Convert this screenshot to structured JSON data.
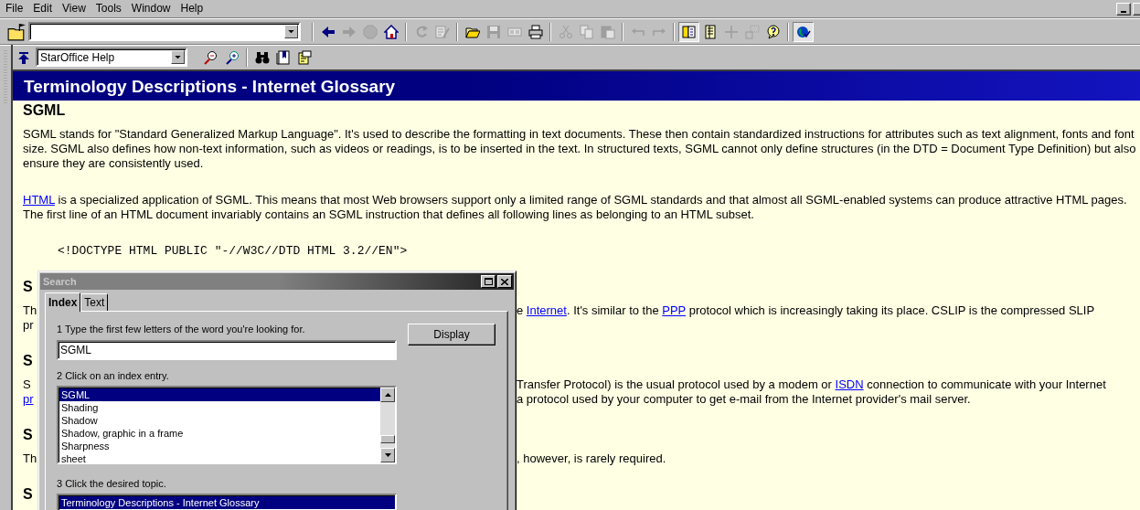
{
  "menu": [
    {
      "label": "File"
    },
    {
      "label": "Edit"
    },
    {
      "label": "View"
    },
    {
      "label": "Tools"
    },
    {
      "label": "Window"
    },
    {
      "label": "Help"
    }
  ],
  "toolbar": {
    "lead": [
      {
        "kind": "folder-flag",
        "disabled": false,
        "pressed": false
      }
    ],
    "groups": [
      [
        {
          "kind": "arrow-left",
          "disabled": false,
          "pressed": false
        },
        {
          "kind": "arrow-right",
          "disabled": true,
          "pressed": false
        },
        {
          "kind": "octagon",
          "disabled": true,
          "pressed": false
        },
        {
          "kind": "home",
          "disabled": false,
          "pressed": false
        }
      ],
      [
        {
          "kind": "refresh",
          "disabled": true,
          "pressed": false
        },
        {
          "kind": "document-pencil",
          "disabled": true,
          "pressed": false
        }
      ],
      [
        {
          "kind": "open-folder",
          "disabled": false,
          "pressed": false
        },
        {
          "kind": "save",
          "disabled": true,
          "pressed": false
        },
        {
          "kind": "form-field",
          "disabled": true,
          "pressed": false
        },
        {
          "kind": "printer",
          "disabled": false,
          "pressed": false
        }
      ],
      [
        {
          "kind": "scissors",
          "disabled": true,
          "pressed": false
        },
        {
          "kind": "copy",
          "disabled": true,
          "pressed": false
        },
        {
          "kind": "paste",
          "disabled": true,
          "pressed": false
        }
      ],
      [
        {
          "kind": "undo",
          "disabled": true,
          "pressed": false
        },
        {
          "kind": "redo",
          "disabled": true,
          "pressed": false
        }
      ],
      [
        {
          "kind": "book",
          "disabled": false,
          "pressed": true
        },
        {
          "kind": "list",
          "disabled": false,
          "pressed": false
        },
        {
          "kind": "crosshair",
          "disabled": true,
          "pressed": false
        },
        {
          "kind": "grid",
          "disabled": true,
          "pressed": false
        },
        {
          "kind": "help",
          "disabled": false,
          "pressed": false
        }
      ],
      [
        {
          "kind": "globe",
          "disabled": false,
          "pressed": true
        }
      ]
    ]
  },
  "help_toolbar": {
    "lead": [
      {
        "kind": "arrow-up",
        "disabled": false,
        "pressed": false
      }
    ],
    "combo": "StarOffice Help",
    "groups": [
      [
        {
          "kind": "zoom-out",
          "disabled": false,
          "pressed": false
        },
        {
          "kind": "zoom-in",
          "disabled": false,
          "pressed": false
        }
      ],
      [
        {
          "kind": "binoculars",
          "disabled": false,
          "pressed": false
        },
        {
          "kind": "bookmark",
          "disabled": false,
          "pressed": false
        },
        {
          "kind": "notes",
          "disabled": false,
          "pressed": false
        }
      ]
    ]
  },
  "document": {
    "title": "Terminology Descriptions - Internet Glossary",
    "heading": "SGML",
    "paragraphs": [
      [
        {
          "text": "SGML stands for \"Standard Generalized Markup Language\". It's used to describe the formatting in text documents. These then contain standardized instructions for attributes such as text alignment, fonts and font size. SGML also defines how non-text information, such as videos or readings, is to be inserted in the text. In structured texts, SGML cannot only define structures (in the DTD = Document Type Definition) but also ensure they are consistently used.",
          "link": false
        }
      ],
      [
        {
          "text": "HTML",
          "link": true
        },
        {
          "text": " is a specialized application of SGML. This means that most Web browsers support only a limited range of SGML standards and that almost all SGML-enabled systems can produce attractive HTML pages. The first line of an HTML document invariably contains an SGML instruction that defines all following lines as belonging to an HTML subset.",
          "link": false
        }
      ]
    ],
    "code": "<!DOCTYPE HTML PUBLIC \"-//W3C//DTD HTML 3.2//EN\">",
    "cut_sections": [
      {
        "heading": "S",
        "lines": [
          {
            "left": [
              {
                "text": "Th",
                "link": false
              }
            ],
            "right": [
              {
                "text": "e ",
                "link": false
              },
              {
                "text": "Internet",
                "link": true
              },
              {
                "text": ". It's similar to the ",
                "link": false
              },
              {
                "text": "PPP",
                "link": true
              },
              {
                "text": " protocol which is increasingly taking its place. CSLIP is the compressed SLIP",
                "link": false
              }
            ]
          },
          {
            "left": [
              {
                "text": "pr",
                "link": false
              }
            ]
          }
        ]
      },
      {
        "heading": "S",
        "lines": [
          {
            "left": [
              {
                "text": "S",
                "link": false
              }
            ],
            "right": [
              {
                "text": "Transfer Protocol) is the usual protocol used by a modem or ",
                "link": false
              },
              {
                "text": "ISDN",
                "link": true
              },
              {
                "text": " connection to communicate with your Internet",
                "link": false
              }
            ]
          },
          {
            "left": [
              {
                "text": "pr",
                "link": true
              }
            ],
            "right": [
              {
                "text": "a protocol used by your computer to get e-mail from the Internet provider's mail server.",
                "link": false
              }
            ]
          }
        ]
      },
      {
        "heading": "S",
        "lines": [
          {
            "left": [
              {
                "text": "Th",
                "link": false
              }
            ],
            "right": [
              {
                "text": ", however, is rarely required.",
                "link": false
              }
            ]
          }
        ]
      },
      {
        "heading": "S"
      }
    ]
  },
  "search_dialog": {
    "title": "Search",
    "tabs": [
      {
        "label": "Index",
        "selected": true
      },
      {
        "label": "Text",
        "selected": false
      }
    ],
    "step1": "1 Type the first few letters of the word you're looking for.",
    "search_value": "SGML",
    "display_button": "Display",
    "step2": "2 Click on an index entry.",
    "index_entries": [
      {
        "label": "SGML",
        "selected": true
      },
      {
        "label": "Shading",
        "selected": false
      },
      {
        "label": "Shadow",
        "selected": false
      },
      {
        "label": "Shadow, graphic in a frame",
        "selected": false
      },
      {
        "label": "Sharpness",
        "selected": false
      },
      {
        "label": "sheet",
        "selected": false
      }
    ],
    "step3": "3 Click the desired topic.",
    "topics": [
      {
        "label": "Terminology Descriptions - Internet Glossary",
        "selected": true
      }
    ]
  }
}
